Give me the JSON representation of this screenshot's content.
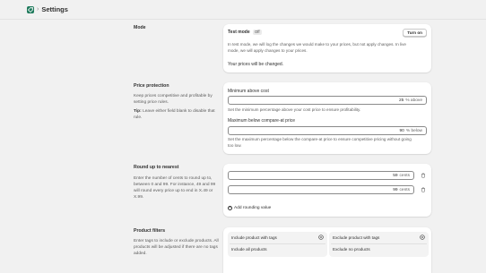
{
  "header": {
    "title": "Settings",
    "app_icon": "app-logo-icon",
    "separator_icon": "chevron-right-icon"
  },
  "mode": {
    "title": "Mode",
    "test_mode_label": "Test mode",
    "test_mode_status": "Off",
    "turn_on_label": "Turn on",
    "help_line1": "In test mode, we will log the changes we would make to your prices, but not apply changes. In live",
    "help_line2": "mode, we will apply changes to your prices.",
    "status": "Your prices will be changed."
  },
  "price_protection": {
    "title": "Price protection",
    "desc": "Keep prices competitive and profitable by setting price rules.",
    "tip_label": "Tip:",
    "tip_text": "Leave either field blank to disable that rule.",
    "min_label": "Minimum above cost",
    "min_value": "25",
    "min_suffix": "% above",
    "min_help": "Set the minimum percentage above your cost price to ensure profitability.",
    "max_label": "Maximum below compare-at price",
    "max_value": "90",
    "max_suffix": "% below",
    "max_help_line1": "Set the maximum percentage below the compare-at price to ensure competitive pricing without going",
    "max_help_line2": "too low."
  },
  "rounding": {
    "title": "Round up to nearest",
    "desc": "Enter the number of cents to round up to, between 0 and 99. For instance, 49 and 99 will round every price up to end in X.49 or X.99.",
    "rows": [
      {
        "value": "59",
        "suffix": "cents"
      },
      {
        "value": "99",
        "suffix": "cents"
      }
    ],
    "add_label": "Add rounding value"
  },
  "filters": {
    "title": "Product filters",
    "desc": "Enter tags to include or exclude products. All products will be adjusted if there are no tags added.",
    "include_header": "Include product with tags",
    "include_value": "Include all products",
    "exclude_header": "Exclude product with tags",
    "exclude_value": "Exclude no products"
  },
  "colors": {
    "background": "#f1f1f1",
    "card": "#ffffff",
    "app_icon": "#1f7a5c",
    "text": "#303030"
  }
}
